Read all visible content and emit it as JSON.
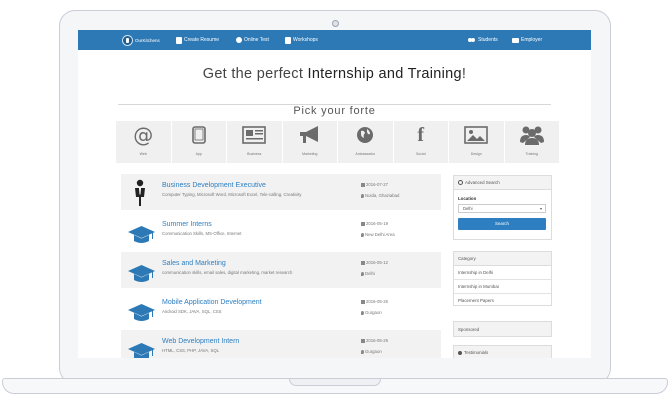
{
  "nav": {
    "brand": "OurKitchens",
    "create_resume": "Create Resume",
    "online_test": "Online Test",
    "workshops": "Workshops",
    "students": "Students",
    "employer": "Employer"
  },
  "hero": {
    "title_prefix": "Get the perfect ",
    "title_emphasis": "Internship and Training",
    "title_suffix": "!"
  },
  "forte": {
    "title": "Pick your forte",
    "categories": [
      {
        "label": "Web",
        "icon": "at-icon"
      },
      {
        "label": "App",
        "icon": "tablet-icon"
      },
      {
        "label": "Business",
        "icon": "newspaper-icon"
      },
      {
        "label": "Marketing",
        "icon": "megaphone-icon"
      },
      {
        "label": "Ambassador",
        "icon": "globe-icon"
      },
      {
        "label": "Social",
        "icon": "facebook-icon"
      },
      {
        "label": "Design",
        "icon": "picture-icon"
      },
      {
        "label": "Training",
        "icon": "group-icon"
      }
    ]
  },
  "jobs": [
    {
      "title": "Business Development Executive",
      "skills": "Computer Typing, Microsoft Word, Microsoft Excel, Tele-calling, Creativity",
      "date": "2016-07-27",
      "location": "Noida, Ghaziabad",
      "icon": "person-icon"
    },
    {
      "title": "Summer Interns",
      "skills": "Communication Skills, MS-Office, Internet",
      "date": "2016-05-19",
      "location": "New Delhi Area",
      "icon": "graduation-cap-icon"
    },
    {
      "title": "Sales and Marketing",
      "skills": "communication skills, email sales, digital marketing, market research",
      "date": "2016-05-12",
      "location": "Delhi",
      "icon": "graduation-cap-icon"
    },
    {
      "title": "Mobile Application Development",
      "skills": "Android SDK, JAVA, SQL, CSS",
      "date": "2016-05-26",
      "location": "Gurgaon",
      "icon": "graduation-cap-icon"
    },
    {
      "title": "Web Development Intern",
      "skills": "HTML, CSS, PHP, JAVA, SQL",
      "date": "2016-05-26",
      "location": "Gurgaon",
      "icon": "graduation-cap-icon"
    }
  ],
  "sidebar": {
    "advanced_search": {
      "heading": "Advanced Search",
      "location_label": "Location",
      "location_value": "Delhi",
      "button": "Search"
    },
    "category": {
      "heading": "Category",
      "items": [
        "Internship in Delhi",
        "Internship in Mumbai",
        "Placement Papers"
      ]
    },
    "sponsored": "Sponsored",
    "testimonials": "Testimonials"
  },
  "colors": {
    "brand_blue": "#2d79b5",
    "link_blue": "#2d7fc1"
  }
}
